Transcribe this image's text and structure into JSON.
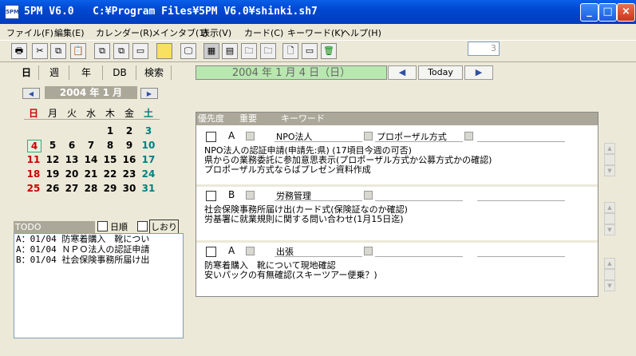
{
  "window": {
    "app_icon_text": "5PM",
    "title": "5PM V6.0   C:¥Program Files¥5PM V6.0¥shinki.sh7"
  },
  "menu": [
    "ファイル(F)",
    "編集(E)",
    "カレンダー(R)",
    "メインタブ(1)",
    "表示(V)",
    "カード(C)",
    "キーワード(K)",
    "ヘルプ(H)"
  ],
  "toolbar": {
    "counter_value": "3",
    "buttons": [
      "print-icon",
      "cut-icon",
      "copy-icon",
      "paste-icon",
      "copy2-icon",
      "paste2-icon",
      "card-icon",
      "note-icon",
      "monitor-icon",
      "grid-icon",
      "layout-icon",
      "folder-icon",
      "folder2-icon",
      "page-icon",
      "blank-icon",
      "trash-icon"
    ]
  },
  "left_tabs": [
    "日",
    "週",
    "年",
    "DB",
    "検索"
  ],
  "calendar": {
    "month_label": "2004 年 1 月",
    "weekday_headers": [
      "日",
      "月",
      "火",
      "水",
      "木",
      "金",
      "土"
    ],
    "weeks": [
      [
        "",
        "",
        "",
        "",
        "1",
        "2",
        "3"
      ],
      [
        "4",
        "5",
        "6",
        "7",
        "8",
        "9",
        "10"
      ],
      [
        "11",
        "12",
        "13",
        "14",
        "15",
        "16",
        "17"
      ],
      [
        "18",
        "19",
        "20",
        "21",
        "22",
        "23",
        "24"
      ],
      [
        "25",
        "26",
        "27",
        "28",
        "29",
        "30",
        "31"
      ]
    ],
    "selected_day": "4"
  },
  "todo": {
    "header": "TODO",
    "opt_daily": "日順",
    "opt_bookmark": "しおり",
    "items": [
      "A：01/04 防寒着購入　靴につい",
      "A：01/04 ＮＰＯ法人の認証申請",
      "B：01/04 社会保険事務所届け出"
    ]
  },
  "date_bar": {
    "current_date": "2004 年 1 月 4 日（日）",
    "today_label": "Today"
  },
  "panel_header": {
    "priority": "優先度",
    "importance": "重要",
    "keyword": "キーワード"
  },
  "entries": [
    {
      "priority": "A",
      "keyword1": "NPO法人",
      "keyword2": "プロポーザル方式",
      "lines": [
        "NPO法人の認証申請(申請先:県) (17頃目今週の可否)",
        "県からの業務委託に参加意思表示(プロポーザル方式か公募方式かの確認)",
        "プロポーザル方式ならばプレゼン資料作成"
      ]
    },
    {
      "priority": "B",
      "keyword1": "労務管理",
      "keyword2": "",
      "lines": [
        "社会保険事務所届け出(カード式(保険証なのか確認)",
        "労基署に就業規則に関する問い合わせ(1月15日迄)"
      ]
    },
    {
      "priority": "A",
      "keyword1": "出張",
      "keyword2": "",
      "lines": [
        "防寒着購入　靴について現地確認",
        "安いパックの有無確認(スキーツアー便乗？)"
      ]
    }
  ],
  "colors": {
    "titlebar": "#0047D0",
    "date_bar_bg": "#b8e8b0",
    "sunday": "#CC0000",
    "saturday": "#008080"
  }
}
